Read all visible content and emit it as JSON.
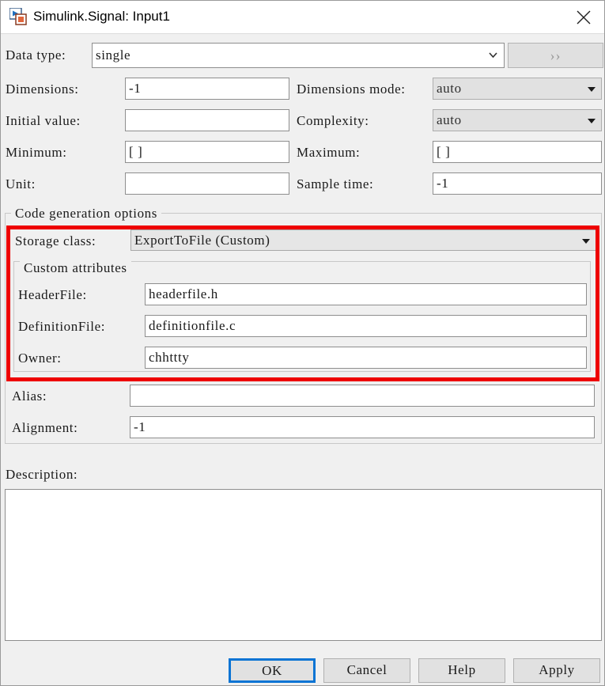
{
  "window": {
    "title": "Simulink.Signal: Input1",
    "icon": "simulink-signal-icon",
    "close_icon": "close-icon"
  },
  "form": {
    "data_type": {
      "label": "Data type:",
      "value": "single"
    },
    "expand_button": {
      "label": "››",
      "enabled": false
    },
    "dimensions": {
      "label": "Dimensions:",
      "value": "-1"
    },
    "dimensions_mode": {
      "label": "Dimensions mode:",
      "value": "auto"
    },
    "initial_value": {
      "label": "Initial value:",
      "value": ""
    },
    "complexity": {
      "label": "Complexity:",
      "value": "auto"
    },
    "minimum": {
      "label": "Minimum:",
      "value": "[ ]"
    },
    "maximum": {
      "label": "Maximum:",
      "value": "[ ]"
    },
    "unit": {
      "label": "Unit:",
      "value": ""
    },
    "sample_time": {
      "label": "Sample time:",
      "value": "-1"
    }
  },
  "code_generation": {
    "group_title": "Code generation options",
    "storage_class": {
      "label": "Storage class:",
      "value": "ExportToFile (Custom)"
    },
    "custom_attributes": {
      "group_title": "Custom attributes",
      "header_file": {
        "label": "HeaderFile:",
        "value": "headerfile.h"
      },
      "definition_file": {
        "label": "DefinitionFile:",
        "value": "definitionfile.c"
      },
      "owner": {
        "label": "Owner:",
        "value": "chhttty"
      }
    },
    "alias": {
      "label": "Alias:",
      "value": ""
    },
    "alignment": {
      "label": "Alignment:",
      "value": "-1"
    }
  },
  "description": {
    "label": "Description:",
    "value": ""
  },
  "buttons": {
    "ok": "OK",
    "cancel": "Cancel",
    "help": "Help",
    "apply": "Apply"
  },
  "colors": {
    "highlight": "#ee0000",
    "focus": "#0a74d4",
    "dialog_bg": "#f0f0f0"
  }
}
